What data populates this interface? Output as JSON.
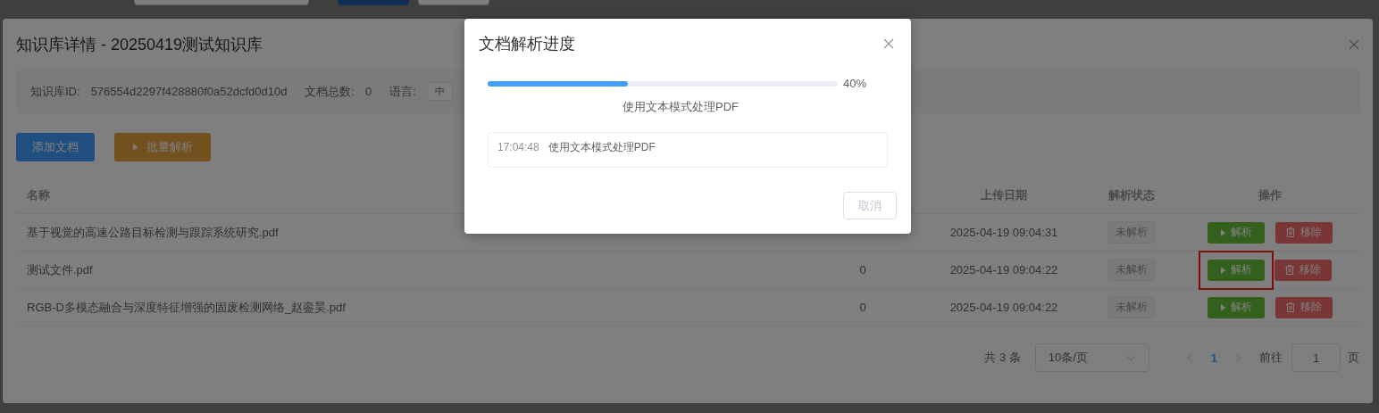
{
  "main_dialog": {
    "title": "知识库详情 - 20250419测试知识库",
    "info": [
      {
        "label": "知识库ID:",
        "value": "576554d2297f428880f0a52dcfd0d10d",
        "kind": "text"
      },
      {
        "label": "文档总数:",
        "value": "0",
        "kind": "text"
      },
      {
        "label": "语言:",
        "value": "中",
        "kind": "tag"
      }
    ],
    "buttons": [
      {
        "label": "添加文档",
        "kind": "primary"
      },
      {
        "label": "批量解析",
        "kind": "warning"
      }
    ],
    "table": {
      "columns": [
        "名称",
        "上传日期",
        "解析状态",
        "操作"
      ],
      "rows": [
        {
          "name": "基于视觉的高速公路目标检测与跟踪系统研究.pdf",
          "date": "2025-04-19 09:04:31",
          "status": "未解析",
          "actions": [
            "解析",
            "移除"
          ],
          "highlighted": false
        },
        {
          "name": "测试文件.pdf",
          "column_2": "0",
          "date": "2025-04-19 09:04:22",
          "status": "未解析",
          "actions": [
            "解析",
            "移除"
          ],
          "highlighted": true
        },
        {
          "name": "RGB-D多模态融合与深度特征增强的固废检测网络_赵銮昊.pdf",
          "column_2": "0",
          "date": "2025-04-19 09:04:22",
          "status": "未解析",
          "actions": [
            "解析",
            "移除"
          ],
          "highlighted": false
        }
      ]
    },
    "pagination": {
      "total": "共 3 条",
      "page_size": "10条/页",
      "pages": [
        {
          "label": "1",
          "selected": true
        }
      ],
      "goto_label": "前往",
      "goto_value": "1",
      "page_suffix": "页"
    }
  },
  "progress_dialog": {
    "title": "文档解析进度",
    "level": 0.4,
    "percent": "40%",
    "status": "使用文本模式处理PDF",
    "log": [
      {
        "time": "17:04:48",
        "message": "使用文本模式处理PDF"
      }
    ],
    "buttons": [
      "取消"
    ]
  }
}
